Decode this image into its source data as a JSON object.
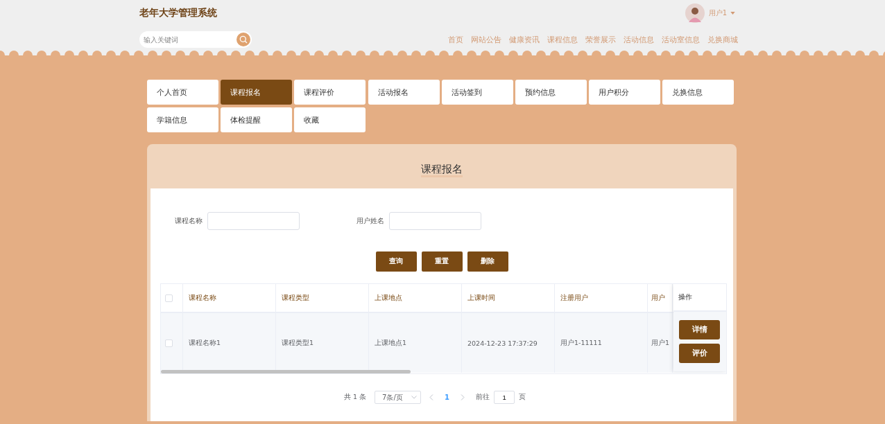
{
  "header": {
    "title": "老年大学管理系统",
    "search": {
      "placeholder": "输入关键词"
    },
    "user": {
      "name": "用户1"
    },
    "nav": [
      {
        "label": "首页"
      },
      {
        "label": "网站公告"
      },
      {
        "label": "健康资讯"
      },
      {
        "label": "课程信息"
      },
      {
        "label": "荣誉展示"
      },
      {
        "label": "活动信息"
      },
      {
        "label": "活动室信息"
      },
      {
        "label": "兑换商城"
      }
    ]
  },
  "tabs": [
    {
      "label": "个人首页",
      "selected": false
    },
    {
      "label": "课程报名",
      "selected": true
    },
    {
      "label": "课程评价",
      "selected": false
    },
    {
      "label": "活动报名",
      "selected": false
    },
    {
      "label": "活动签到",
      "selected": false
    },
    {
      "label": "预约信息",
      "selected": false
    },
    {
      "label": "用户积分",
      "selected": false
    },
    {
      "label": "兑换信息",
      "selected": false
    },
    {
      "label": "学籍信息",
      "selected": false
    },
    {
      "label": "体检提醒",
      "selected": false
    },
    {
      "label": "收藏",
      "selected": false
    }
  ],
  "panel": {
    "title": "课程报名",
    "filters": [
      {
        "label": "课程名称"
      },
      {
        "label": "用户姓名"
      }
    ],
    "buttons": [
      "查询",
      "重置",
      "删除"
    ],
    "table": {
      "header_checked": false,
      "columns": [
        "课程名称",
        "课程类型",
        "上课地点",
        "上课时间",
        "注册用户",
        "用户"
      ],
      "action_column": "操作",
      "rows": [
        {
          "checked": false,
          "cells": [
            "课程名称1",
            "课程类型1",
            "上课地点1",
            "2024-12-23 17:37:29",
            "用户1-11111",
            "用户1"
          ],
          "actions": [
            "详情",
            "评价"
          ]
        }
      ]
    },
    "pagination": {
      "total": "共 1 条",
      "page_size": "7条/页",
      "pages": [
        {
          "label": "1",
          "selected": true
        }
      ],
      "goto_label": "前往",
      "goto_value": "1",
      "goto_suffix": "页"
    }
  }
}
